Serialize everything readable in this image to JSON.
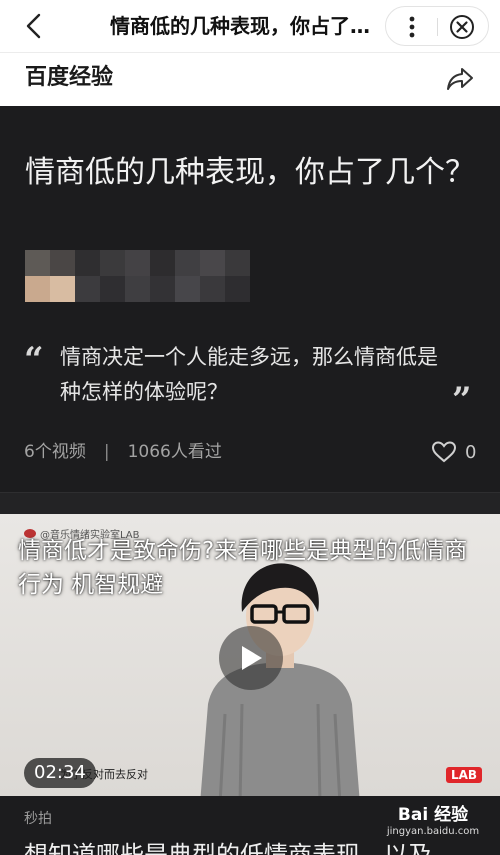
{
  "topbar": {
    "title": "情商低的几种表现，你占了几个？"
  },
  "site": {
    "name": "百度经验"
  },
  "article": {
    "title": "情商低的几种表现，你占了几个？",
    "quote": "情商决定一个人能走多远，那么情商低是种怎样的体验呢？",
    "quote_open": "“",
    "quote_close": "”",
    "videos_count": "6个视频",
    "stats_divider": "|",
    "views": "1066人看过",
    "likes": "0"
  },
  "video": {
    "source": "@音乐情绪实验室LAB",
    "title": "情商低才是致命伤?来看哪些是典型的低情商行为 机智规避",
    "subtitle": "为了反对而去反对",
    "duration": "02:34",
    "badge": "LAB"
  },
  "bottom": {
    "label": "秒拍",
    "next_title": "想知道哪些是典型的低情商表现，以及",
    "watermark_main": "Bai 经验",
    "watermark_url": "jingyan.baidu.com"
  },
  "colors": {
    "dark_background": "#1c1c1e",
    "accent_red": "#e0262a"
  },
  "icons": {
    "back": "chevron-left-icon",
    "more": "more-vertical-icon",
    "close": "close-circle-icon",
    "share": "share-arrow-icon",
    "like": "heart-outline-icon",
    "play": "play-icon"
  }
}
